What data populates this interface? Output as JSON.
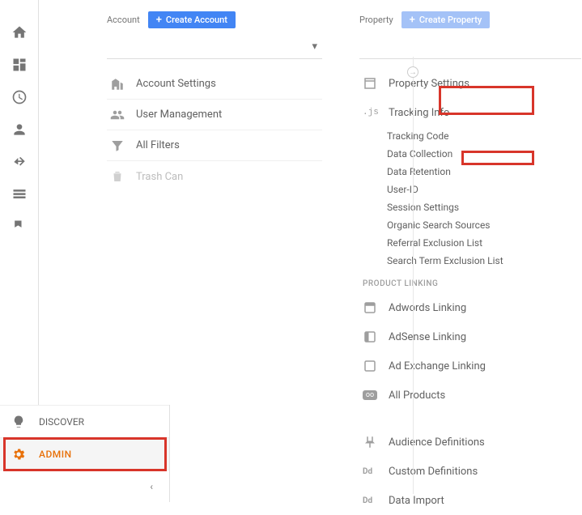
{
  "rail": {
    "discover": "DISCOVER",
    "admin": "ADMIN"
  },
  "account": {
    "header": "Account",
    "create_btn": "Create Account",
    "items": [
      {
        "label": "Account Settings"
      },
      {
        "label": "User Management"
      },
      {
        "label": "All Filters"
      },
      {
        "label": "Trash Can"
      }
    ]
  },
  "property": {
    "header": "Property",
    "create_btn": "Create Property",
    "items": [
      {
        "label": "Property Settings"
      },
      {
        "label": "Tracking Info"
      }
    ],
    "tracking_sub": [
      "Tracking Code",
      "Data Collection",
      "Data Retention",
      "User-ID",
      "Session Settings",
      "Organic Search Sources",
      "Referral Exclusion List",
      "Search Term Exclusion List"
    ],
    "product_linking_header": "PRODUCT LINKING",
    "product_linking": [
      "Adwords Linking",
      "AdSense Linking",
      "Ad Exchange Linking",
      "All Products"
    ],
    "more": [
      "Audience Definitions",
      "Custom Definitions",
      "Data Import"
    ]
  }
}
